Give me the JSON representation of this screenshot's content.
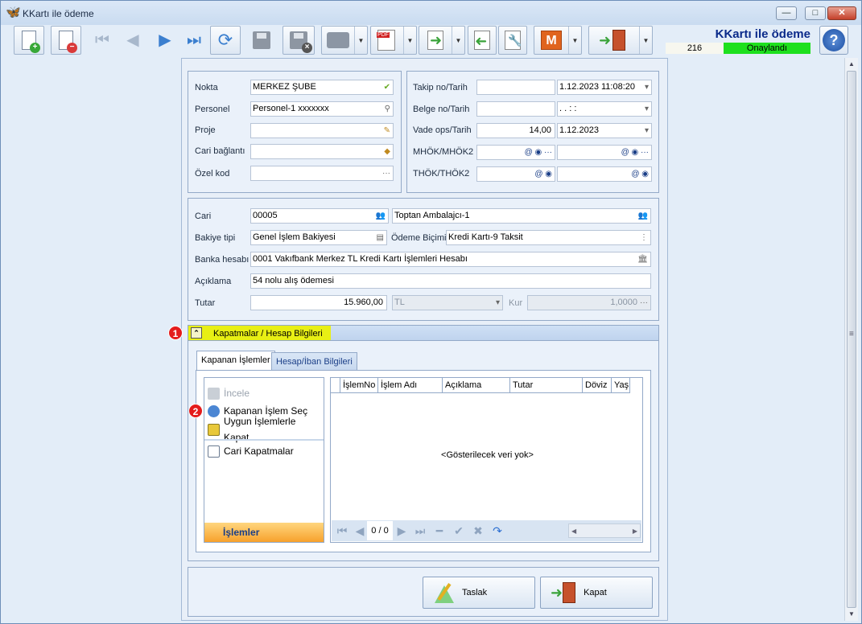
{
  "window": {
    "title": "KKartı ile ödeme",
    "minimize": "—",
    "maximize": "□",
    "close": "✕"
  },
  "header": {
    "title": "KKartı ile ödeme",
    "number": "216",
    "status": "Onaylandı",
    "status_color": "#1ee01e",
    "help": "?"
  },
  "toolbar": {
    "m_label": "M"
  },
  "left_form": {
    "nokta_label": "Nokta",
    "nokta_value": "MERKEZ ŞUBE",
    "personel_label": "Personel",
    "personel_value": "Personel-1 xxxxxxx",
    "proje_label": "Proje",
    "proje_value": "",
    "cari_baglanti_label": "Cari bağlantı",
    "cari_baglanti_value": "",
    "ozel_kod_label": "Özel kod",
    "ozel_kod_value": ""
  },
  "right_form": {
    "takip_label": "Takip no/Tarih",
    "takip_no": "",
    "takip_tarih": "1.12.2023 11:08:20",
    "belge_label": "Belge no/Tarih",
    "belge_no": "",
    "belge_tarih": " .  .       :  :",
    "vade_label": "Vade ops/Tarih",
    "vade_ops": "14,00",
    "vade_tarih": "1.12.2023",
    "mhok_label": "MHÖK/MHÖK2",
    "thok_label": "THÖK/THÖK2"
  },
  "mid_form": {
    "cari_label": "Cari",
    "cari_code": "00005",
    "cari_name": "Toptan Ambalajcı-1",
    "bakiye_label": "Bakiye tipi",
    "bakiye_value": "Genel İşlem Bakiyesi",
    "odeme_label": "Ödeme Biçimi",
    "odeme_value": "Kredi Kartı-9 Taksit",
    "banka_label": "Banka hesabı",
    "banka_value": "0001 Vakıfbank Merkez TL Kredi Kartı İşlemleri Hesabı",
    "aciklama_label": "Açıklama",
    "aciklama_value": "54 nolu alış ödemesi",
    "tutar_label": "Tutar",
    "tutar_value": "15.960,00",
    "currency_value": "TL",
    "kur_label": "Kur",
    "kur_value": "1,0000"
  },
  "section": {
    "title": "Kapatmalar / Hesap Bilgileri",
    "marker1": "1",
    "marker2": "2"
  },
  "tabs": [
    {
      "label": "Kapanan İşlemler"
    },
    {
      "label": "Hesap/İban Bilgileri"
    }
  ],
  "side_menu": {
    "items": [
      {
        "label": "İncele"
      },
      {
        "label": "Kapanan İşlem Seç"
      },
      {
        "label": "Uygun İşlemlerle Kapat"
      },
      {
        "label": "Cari Kapatmalar"
      }
    ],
    "footer": "İşlemler"
  },
  "grid": {
    "columns": [
      "İşlemNo",
      "İşlem Adı",
      "Açıklama",
      "Tutar",
      "Döviz",
      "Yaş"
    ],
    "empty_text": "<Gösterilecek veri yok>",
    "page": "0 / 0"
  },
  "buttons": {
    "draft": "Taslak",
    "close": "Kapat"
  }
}
